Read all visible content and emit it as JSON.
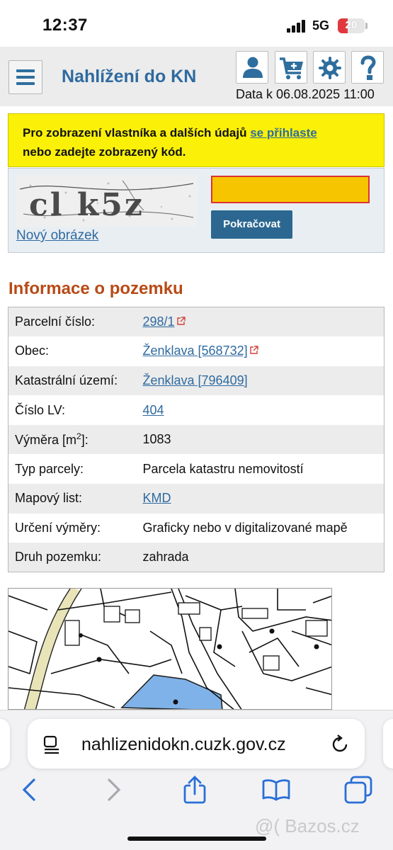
{
  "status": {
    "time": "12:37",
    "network": "5G",
    "battery": "20"
  },
  "header": {
    "title": "Nahlížení do KN",
    "date_line": "Data k 06.08.2025 11:00",
    "icons": [
      "menu-icon",
      "user-icon",
      "cart-icon",
      "gear-icon",
      "help-icon"
    ]
  },
  "notice": {
    "text_before": "Pro zobrazení vlastníka a dalších údajů ",
    "link": "se přihlaste",
    "text_after": "nebo zadejte zobrazený kód."
  },
  "captcha": {
    "code_image_text": "cl k5z",
    "new_image_link": "Nový obrázek",
    "input_value": "",
    "continue_button": "Pokračovat",
    "colors": {
      "input_bg": "#f7c500",
      "input_border": "#dd3333",
      "button_bg": "#2c6791"
    }
  },
  "section": {
    "title": "Informace o pozemku"
  },
  "parcel_info": [
    {
      "label": "Parcelní číslo:",
      "value": "298/1",
      "link": true,
      "external": true
    },
    {
      "label": "Obec:",
      "value": "Ženklava [568732]",
      "link": true,
      "external": true
    },
    {
      "label": "Katastrální území:",
      "value": "Ženklava [796409]",
      "link": true,
      "external": false
    },
    {
      "label": "Číslo LV:",
      "value": "404",
      "link": true,
      "external": false
    },
    {
      "label": "Výměra [m",
      "label_sup": "2",
      "label_end": "]:",
      "value": "1083",
      "link": false,
      "external": false
    },
    {
      "label": "Typ parcely:",
      "value": "Parcela katastru nemovitostí",
      "link": false,
      "external": false
    },
    {
      "label": "Mapový list:",
      "value": "KMD",
      "link": true,
      "external": false
    },
    {
      "label": "Určení výměry:",
      "value": "Graficky nebo v digitalizované mapě",
      "link": false,
      "external": false
    },
    {
      "label": "Druh pozemku:",
      "value": "zahrada",
      "link": false,
      "external": false
    }
  ],
  "map": {
    "highlight_color": "#7fb2e8"
  },
  "browser": {
    "url": "nahlizenidokn.cuzk.gov.cz",
    "icons": [
      "page-menu-icon",
      "reload-icon",
      "back-icon",
      "forward-icon",
      "share-icon",
      "bookmarks-icon",
      "tabs-icon"
    ],
    "watermark": "Bazos.cz"
  }
}
